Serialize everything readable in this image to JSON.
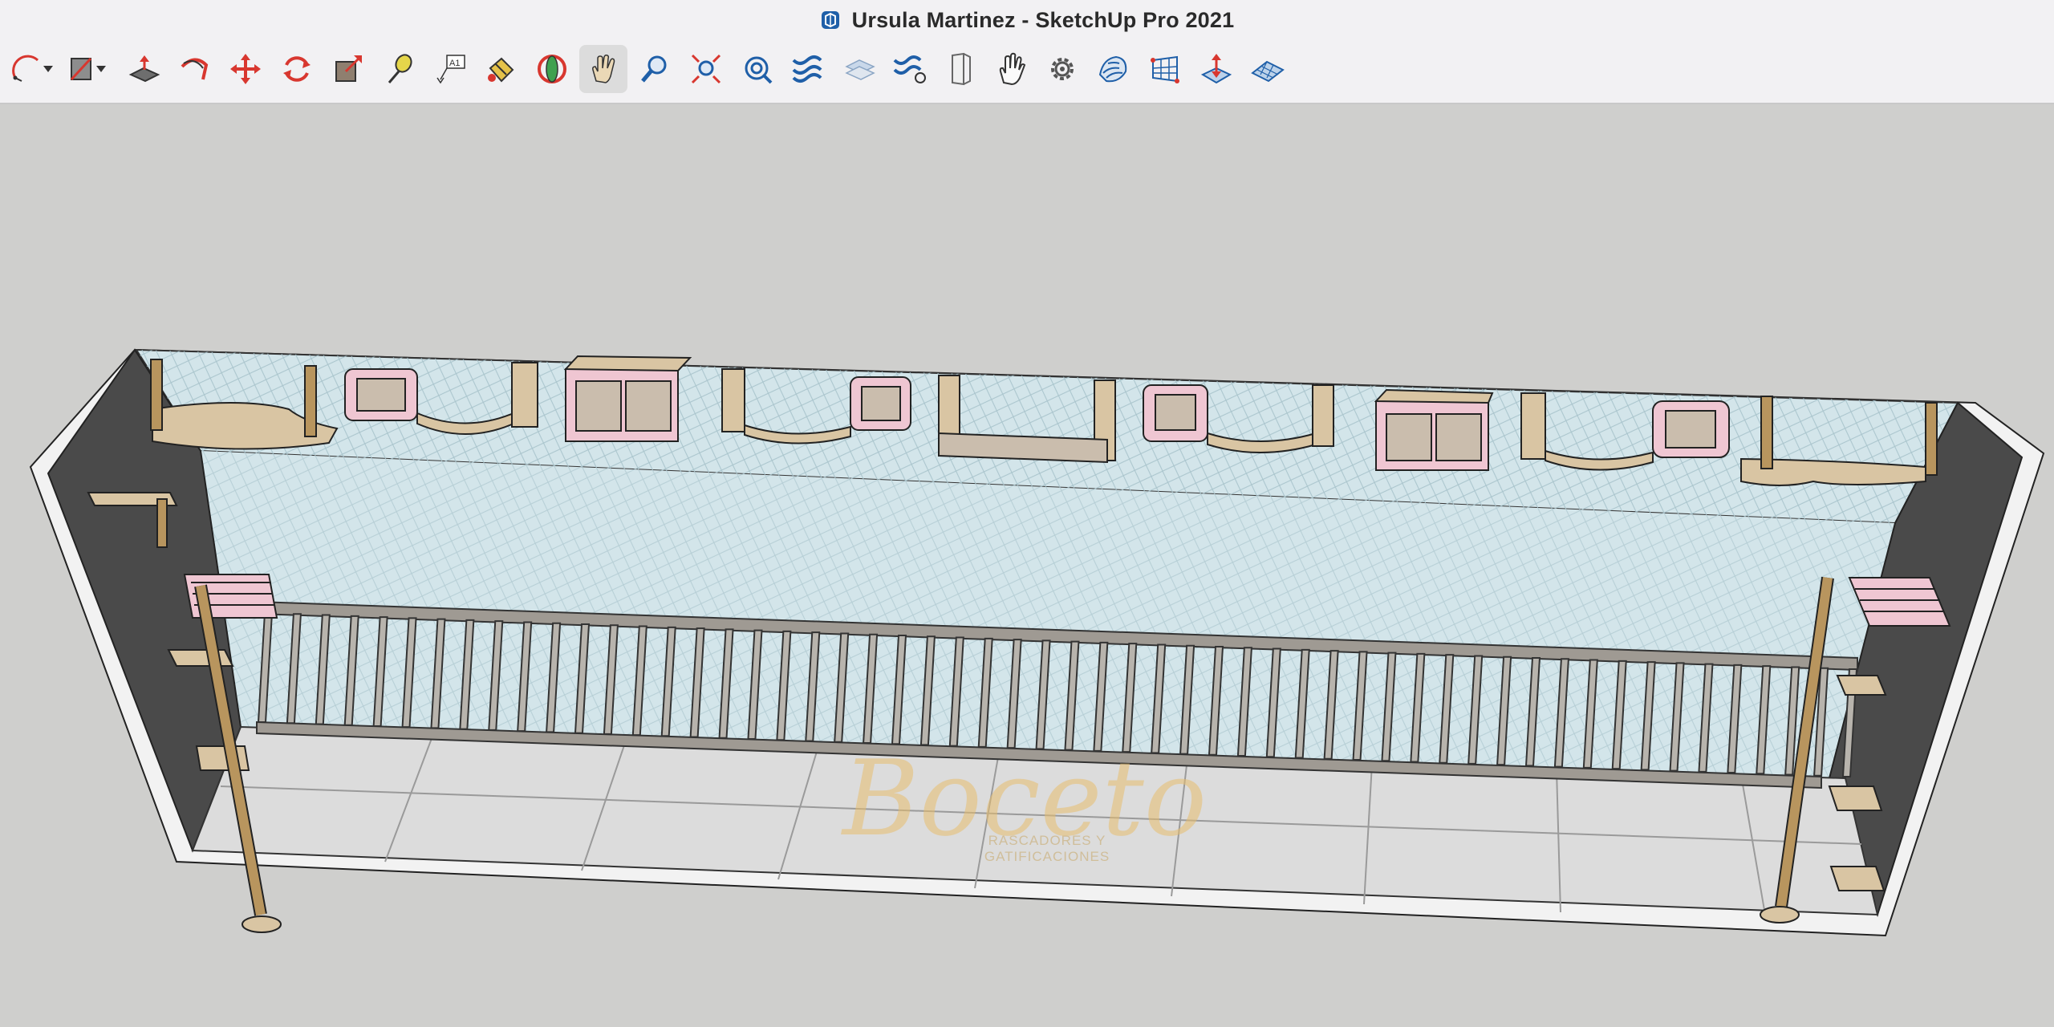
{
  "window": {
    "title": "Ursula Martinez - SketchUp Pro 2021"
  },
  "toolbar": {
    "tools": [
      {
        "name": "arc-tool",
        "icon": "arc-icon",
        "has_dropdown": true
      },
      {
        "name": "eraser-tool",
        "icon": "eraser-icon",
        "has_dropdown": true
      },
      {
        "name": "push-pull-tool",
        "icon": "push-pull-icon"
      },
      {
        "name": "follow-me-tool",
        "icon": "follow-me-icon"
      },
      {
        "name": "move-tool",
        "icon": "move-icon"
      },
      {
        "name": "rotate-tool",
        "icon": "rotate-icon"
      },
      {
        "name": "scale-tool",
        "icon": "scale-icon"
      },
      {
        "name": "tape-measure-tool",
        "icon": "tape-measure-icon"
      },
      {
        "name": "text-tool",
        "icon": "text-label-icon",
        "label": "A1"
      },
      {
        "name": "paint-bucket-tool",
        "icon": "paint-bucket-icon"
      },
      {
        "name": "orbit-tool",
        "icon": "orbit-icon"
      },
      {
        "name": "pan-tool",
        "icon": "pan-hand-icon",
        "active": true
      },
      {
        "name": "zoom-tool",
        "icon": "zoom-icon"
      },
      {
        "name": "zoom-extents-tool",
        "icon": "zoom-extents-icon"
      },
      {
        "name": "previous-view-tool",
        "icon": "previous-view-icon"
      },
      {
        "name": "section-plane-tool",
        "icon": "section-plane-icon"
      },
      {
        "name": "outliner-tool",
        "icon": "outliner-icon"
      },
      {
        "name": "components-tool",
        "icon": "components-icon"
      },
      {
        "name": "door-tool",
        "icon": "door-icon"
      },
      {
        "name": "hand-tool",
        "icon": "hand-icon"
      },
      {
        "name": "settings-tool",
        "icon": "gear-icon"
      },
      {
        "name": "sandbox-tool",
        "icon": "sandbox-icon"
      },
      {
        "name": "grid-tool",
        "icon": "grid-icon"
      },
      {
        "name": "add-location-tool",
        "icon": "location-icon"
      },
      {
        "name": "terrain-tool",
        "icon": "terrain-icon"
      }
    ]
  },
  "viewport": {
    "watermark": {
      "brand": "Boceto",
      "tagline": "RASCADORES Y GATIFICACIONES"
    }
  },
  "colors": {
    "accent_red": "#d8372f",
    "accent_blue": "#1f5fa8",
    "wood": "#d9c5a3",
    "wood_dark": "#b8955e",
    "pink": "#efc6d2",
    "wall": "#4a4a4a",
    "ceiling": "#d3e5ea",
    "floor": "#d7d7d7"
  }
}
